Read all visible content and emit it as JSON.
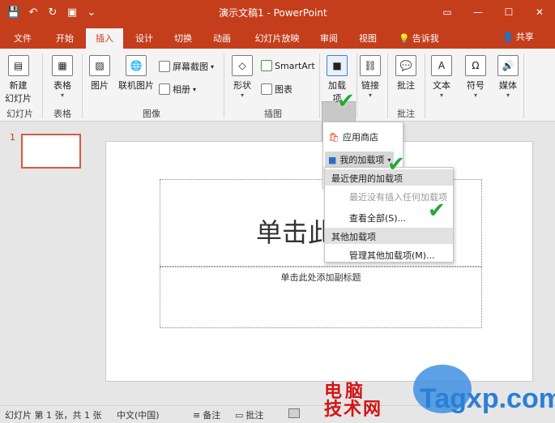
{
  "window": {
    "title": "演示文稿1 - PowerPoint",
    "controls": [
      "▭",
      "—",
      "☐",
      "✕"
    ]
  },
  "qat": {
    "save": "💾",
    "undo": "↶",
    "redo": "↻",
    "present": "▣",
    "more": "⌄"
  },
  "tabs": [
    {
      "label": "文件",
      "active": false
    },
    {
      "label": "开始",
      "active": false
    },
    {
      "label": "插入",
      "active": true
    },
    {
      "label": "设计",
      "active": false
    },
    {
      "label": "切换",
      "active": false
    },
    {
      "label": "动画",
      "active": false
    },
    {
      "label": "幻灯片放映",
      "active": false
    },
    {
      "label": "审阅",
      "active": false
    },
    {
      "label": "视图",
      "active": false
    }
  ],
  "tellme": {
    "icon": "lightbulb-icon",
    "label": "告诉我"
  },
  "share": {
    "icon": "person-icon",
    "label": "共享"
  },
  "ribbon": {
    "new_slide": {
      "line1": "新建",
      "line2": "幻灯片"
    },
    "table": "表格",
    "picture": "图片",
    "online_picture": "联机图片",
    "screenshot": "屏幕截图",
    "album": "相册",
    "shape": "形状",
    "smartart": "SmartArt",
    "chart": "图表",
    "addin": {
      "line1": "加载",
      "line2": "项"
    },
    "link": "链接",
    "comment": "批注",
    "text": "文本",
    "symbol": "符号",
    "media": "媒体",
    "groups": {
      "slides": "幻灯片",
      "tables": "表格",
      "images": "图像",
      "illustrations": "插图",
      "comments": "批注"
    }
  },
  "slide_pane": {
    "number": "1"
  },
  "slide": {
    "title_placeholder": "单击此处添",
    "subtitle_placeholder": "单击此处添加副标题"
  },
  "addin_menu": {
    "store": "应用商店",
    "my_addins": "我的加载项"
  },
  "my_addins_menu": {
    "recent_header": "最近使用的加载项",
    "recent_empty": "最近没有插入任何加载项",
    "view_all": "查看全部(S)...",
    "other_header": "其他加载项",
    "manage": "管理其他加载项(M)..."
  },
  "statusbar": {
    "slide_info": "幻灯片 第 1 张，共 1 张",
    "language": "中文(中国)",
    "notes": "备注",
    "comments": "批注"
  },
  "watermark": {
    "cn_line1": "电脑",
    "cn_line2": "技术网",
    "en": "Tagxp.com"
  }
}
